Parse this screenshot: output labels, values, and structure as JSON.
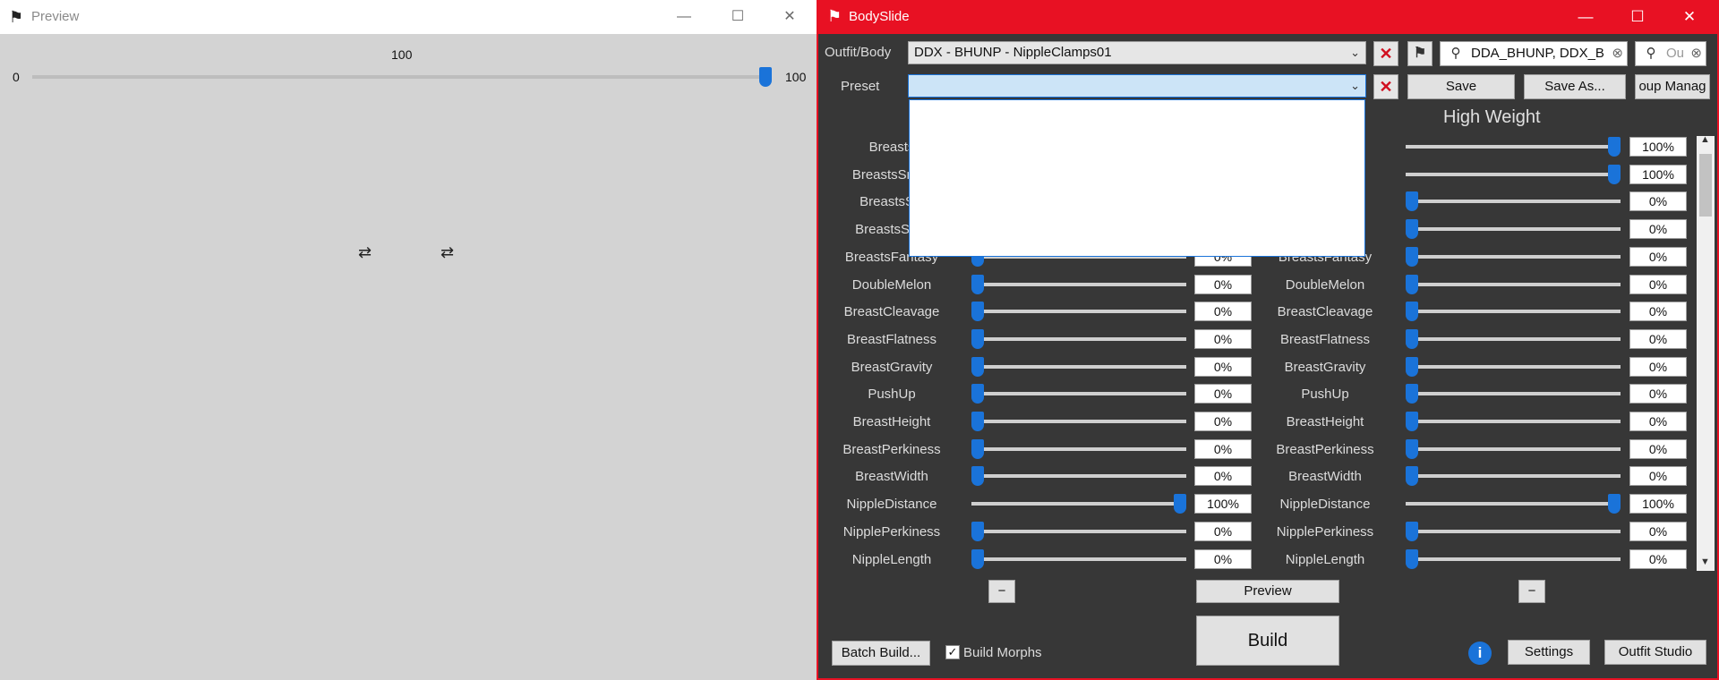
{
  "preview": {
    "title": "Preview",
    "slider": {
      "value_label": "100",
      "min_label": "0",
      "max_label": "100",
      "fraction": 1.0
    },
    "controls": {
      "minimize": "—",
      "maximize": "☐",
      "close": "✕"
    },
    "markers": [
      "⇄",
      "⇄"
    ]
  },
  "bodyslide": {
    "title": "BodySlide",
    "controls": {
      "minimize": "—",
      "maximize": "☐",
      "close": "✕"
    },
    "outfit_label": "Outfit/Body",
    "outfit_value": "DDX - BHUNP - NippleClamps01",
    "preset_label": "Preset",
    "preset_value": "",
    "search_groups": "DDA_BHUNP, DDX_B",
    "search_outfit_placeholder": "Ou",
    "save_label": "Save",
    "save_as_label": "Save As...",
    "group_manager_label": "oup Manag",
    "high_weight_header": "High Weight",
    "sliders": [
      {
        "name": "Breasts",
        "low": "",
        "high": "100%",
        "high_frac": 1.0
      },
      {
        "name": "BreastsSmall",
        "low": "",
        "high": "100%",
        "high_frac": 1.0
      },
      {
        "name": "BreastsSH",
        "low": "",
        "high": "0%",
        "high_frac": 0.0
      },
      {
        "name": "BreastsSSH",
        "low": "",
        "high": "0%",
        "high_frac": 0.0
      },
      {
        "name": "BreastsFantasy",
        "low": "0%",
        "high": "0%",
        "high_frac": 0.0
      },
      {
        "name": "DoubleMelon",
        "low": "0%",
        "high": "0%",
        "high_frac": 0.0
      },
      {
        "name": "BreastCleavage",
        "low": "0%",
        "high": "0%",
        "high_frac": 0.0
      },
      {
        "name": "BreastFlatness",
        "low": "0%",
        "high": "0%",
        "high_frac": 0.0
      },
      {
        "name": "BreastGravity",
        "low": "0%",
        "high": "0%",
        "high_frac": 0.0
      },
      {
        "name": "PushUp",
        "low": "0%",
        "high": "0%",
        "high_frac": 0.0
      },
      {
        "name": "BreastHeight",
        "low": "0%",
        "high": "0%",
        "high_frac": 0.0
      },
      {
        "name": "BreastPerkiness",
        "low": "0%",
        "high": "0%",
        "high_frac": 0.0
      },
      {
        "name": "BreastWidth",
        "low": "0%",
        "high": "0%",
        "high_frac": 0.0
      },
      {
        "name": "NippleDistance",
        "low": "100%",
        "high": "100%",
        "high_frac": 1.0
      },
      {
        "name": "NipplePerkiness",
        "low": "0%",
        "high": "0%",
        "high_frac": 0.0
      },
      {
        "name": "NippleLength",
        "low": "0%",
        "high": "0%",
        "high_frac": 0.0
      }
    ],
    "minus_label": "−",
    "preview_label": "Preview",
    "build_label": "Build",
    "batch_build_label": "Batch Build...",
    "build_morphs_label": "Build Morphs",
    "build_morphs_checked": true,
    "info_icon": "i",
    "settings_label": "Settings",
    "outfit_studio_label": "Outfit Studio",
    "colors": {
      "title_bar": "#e81123",
      "panel": "#373737",
      "accent": "#1a73d9"
    }
  }
}
